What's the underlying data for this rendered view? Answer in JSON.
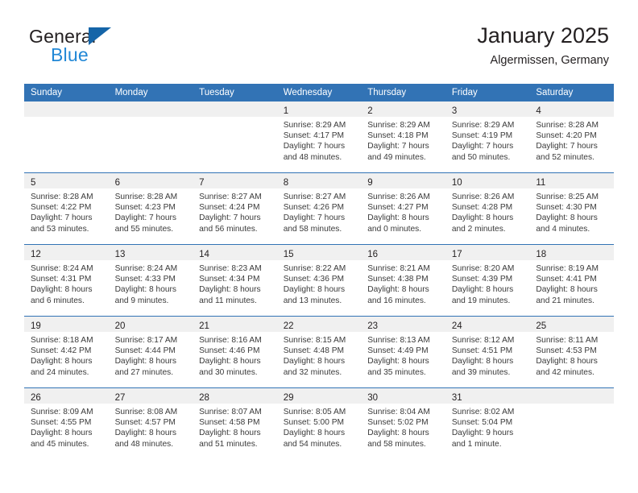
{
  "brand": {
    "name_top": "General",
    "name_bottom": "Blue",
    "triangle_icon": "brand-triangle-icon",
    "accent_color": "#1565a8",
    "accent_color_light": "#2288d6"
  },
  "header": {
    "title": "January 2025",
    "subtitle": "Algermissen, Germany"
  },
  "theme": {
    "header_blue": "#3273b5",
    "daynum_band": "#f0f0f0",
    "text": "#231f20",
    "body_text": "#3a3a3a"
  },
  "weekday_headers": [
    "Sunday",
    "Monday",
    "Tuesday",
    "Wednesday",
    "Thursday",
    "Friday",
    "Saturday"
  ],
  "weeks": [
    [
      {
        "day": "",
        "lines": []
      },
      {
        "day": "",
        "lines": []
      },
      {
        "day": "",
        "lines": []
      },
      {
        "day": "1",
        "lines": [
          "Sunrise: 8:29 AM",
          "Sunset: 4:17 PM",
          "Daylight: 7 hours",
          "and 48 minutes."
        ]
      },
      {
        "day": "2",
        "lines": [
          "Sunrise: 8:29 AM",
          "Sunset: 4:18 PM",
          "Daylight: 7 hours",
          "and 49 minutes."
        ]
      },
      {
        "day": "3",
        "lines": [
          "Sunrise: 8:29 AM",
          "Sunset: 4:19 PM",
          "Daylight: 7 hours",
          "and 50 minutes."
        ]
      },
      {
        "day": "4",
        "lines": [
          "Sunrise: 8:28 AM",
          "Sunset: 4:20 PM",
          "Daylight: 7 hours",
          "and 52 minutes."
        ]
      }
    ],
    [
      {
        "day": "5",
        "lines": [
          "Sunrise: 8:28 AM",
          "Sunset: 4:22 PM",
          "Daylight: 7 hours",
          "and 53 minutes."
        ]
      },
      {
        "day": "6",
        "lines": [
          "Sunrise: 8:28 AM",
          "Sunset: 4:23 PM",
          "Daylight: 7 hours",
          "and 55 minutes."
        ]
      },
      {
        "day": "7",
        "lines": [
          "Sunrise: 8:27 AM",
          "Sunset: 4:24 PM",
          "Daylight: 7 hours",
          "and 56 minutes."
        ]
      },
      {
        "day": "8",
        "lines": [
          "Sunrise: 8:27 AM",
          "Sunset: 4:26 PM",
          "Daylight: 7 hours",
          "and 58 minutes."
        ]
      },
      {
        "day": "9",
        "lines": [
          "Sunrise: 8:26 AM",
          "Sunset: 4:27 PM",
          "Daylight: 8 hours",
          "and 0 minutes."
        ]
      },
      {
        "day": "10",
        "lines": [
          "Sunrise: 8:26 AM",
          "Sunset: 4:28 PM",
          "Daylight: 8 hours",
          "and 2 minutes."
        ]
      },
      {
        "day": "11",
        "lines": [
          "Sunrise: 8:25 AM",
          "Sunset: 4:30 PM",
          "Daylight: 8 hours",
          "and 4 minutes."
        ]
      }
    ],
    [
      {
        "day": "12",
        "lines": [
          "Sunrise: 8:24 AM",
          "Sunset: 4:31 PM",
          "Daylight: 8 hours",
          "and 6 minutes."
        ]
      },
      {
        "day": "13",
        "lines": [
          "Sunrise: 8:24 AM",
          "Sunset: 4:33 PM",
          "Daylight: 8 hours",
          "and 9 minutes."
        ]
      },
      {
        "day": "14",
        "lines": [
          "Sunrise: 8:23 AM",
          "Sunset: 4:34 PM",
          "Daylight: 8 hours",
          "and 11 minutes."
        ]
      },
      {
        "day": "15",
        "lines": [
          "Sunrise: 8:22 AM",
          "Sunset: 4:36 PM",
          "Daylight: 8 hours",
          "and 13 minutes."
        ]
      },
      {
        "day": "16",
        "lines": [
          "Sunrise: 8:21 AM",
          "Sunset: 4:38 PM",
          "Daylight: 8 hours",
          "and 16 minutes."
        ]
      },
      {
        "day": "17",
        "lines": [
          "Sunrise: 8:20 AM",
          "Sunset: 4:39 PM",
          "Daylight: 8 hours",
          "and 19 minutes."
        ]
      },
      {
        "day": "18",
        "lines": [
          "Sunrise: 8:19 AM",
          "Sunset: 4:41 PM",
          "Daylight: 8 hours",
          "and 21 minutes."
        ]
      }
    ],
    [
      {
        "day": "19",
        "lines": [
          "Sunrise: 8:18 AM",
          "Sunset: 4:42 PM",
          "Daylight: 8 hours",
          "and 24 minutes."
        ]
      },
      {
        "day": "20",
        "lines": [
          "Sunrise: 8:17 AM",
          "Sunset: 4:44 PM",
          "Daylight: 8 hours",
          "and 27 minutes."
        ]
      },
      {
        "day": "21",
        "lines": [
          "Sunrise: 8:16 AM",
          "Sunset: 4:46 PM",
          "Daylight: 8 hours",
          "and 30 minutes."
        ]
      },
      {
        "day": "22",
        "lines": [
          "Sunrise: 8:15 AM",
          "Sunset: 4:48 PM",
          "Daylight: 8 hours",
          "and 32 minutes."
        ]
      },
      {
        "day": "23",
        "lines": [
          "Sunrise: 8:13 AM",
          "Sunset: 4:49 PM",
          "Daylight: 8 hours",
          "and 35 minutes."
        ]
      },
      {
        "day": "24",
        "lines": [
          "Sunrise: 8:12 AM",
          "Sunset: 4:51 PM",
          "Daylight: 8 hours",
          "and 39 minutes."
        ]
      },
      {
        "day": "25",
        "lines": [
          "Sunrise: 8:11 AM",
          "Sunset: 4:53 PM",
          "Daylight: 8 hours",
          "and 42 minutes."
        ]
      }
    ],
    [
      {
        "day": "26",
        "lines": [
          "Sunrise: 8:09 AM",
          "Sunset: 4:55 PM",
          "Daylight: 8 hours",
          "and 45 minutes."
        ]
      },
      {
        "day": "27",
        "lines": [
          "Sunrise: 8:08 AM",
          "Sunset: 4:57 PM",
          "Daylight: 8 hours",
          "and 48 minutes."
        ]
      },
      {
        "day": "28",
        "lines": [
          "Sunrise: 8:07 AM",
          "Sunset: 4:58 PM",
          "Daylight: 8 hours",
          "and 51 minutes."
        ]
      },
      {
        "day": "29",
        "lines": [
          "Sunrise: 8:05 AM",
          "Sunset: 5:00 PM",
          "Daylight: 8 hours",
          "and 54 minutes."
        ]
      },
      {
        "day": "30",
        "lines": [
          "Sunrise: 8:04 AM",
          "Sunset: 5:02 PM",
          "Daylight: 8 hours",
          "and 58 minutes."
        ]
      },
      {
        "day": "31",
        "lines": [
          "Sunrise: 8:02 AM",
          "Sunset: 5:04 PM",
          "Daylight: 9 hours",
          "and 1 minute."
        ]
      },
      {
        "day": "",
        "lines": []
      }
    ]
  ]
}
